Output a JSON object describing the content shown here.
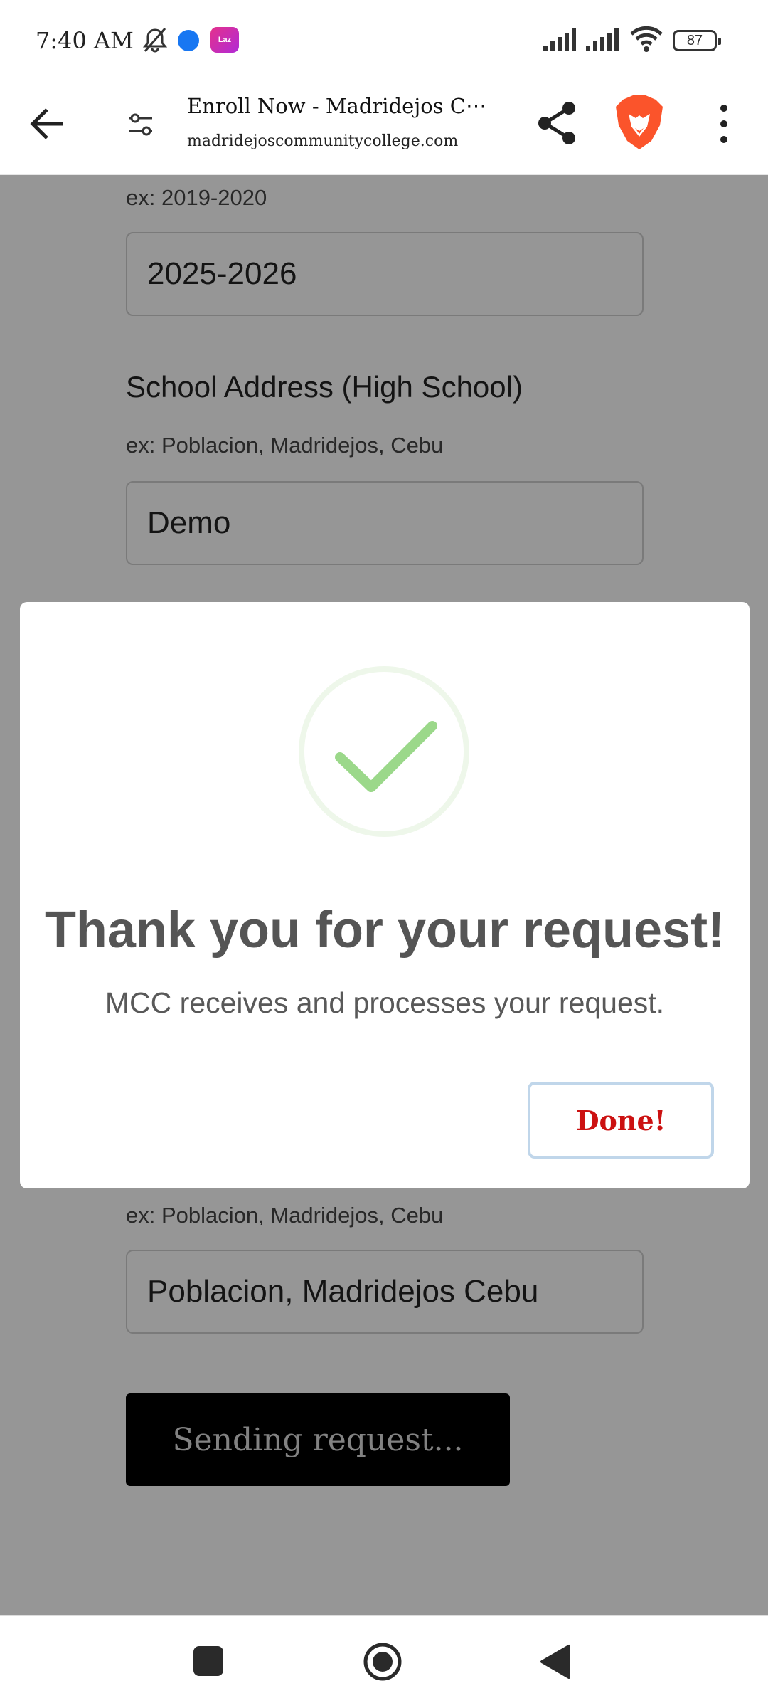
{
  "status_bar": {
    "time": "7:40 AM",
    "battery": "87",
    "icons": [
      "bell-off-icon",
      "messenger-icon",
      "lazada-icon",
      "signal-icon",
      "signal-icon",
      "wifi-icon",
      "battery-icon"
    ],
    "laz_text": "Laz"
  },
  "toolbar": {
    "page_title": "Enroll Now - Madridejos C⋯",
    "url": "madridejoscommunitycollege.com"
  },
  "form": {
    "school_year_hint": "ex: 2019-2020",
    "school_year_value": "2025-2026",
    "hs_address_label": "School Address (High School)",
    "hs_address_hint": "ex: Poblacion, Madridejos, Cebu",
    "hs_address_value": "Demo",
    "address_hint": "ex: Poblacion, Madridejos, Cebu",
    "address_value": "Poblacion, Madridejos Cebu",
    "submit_label": "Sending request..."
  },
  "modal": {
    "title": "Thank you for your request!",
    "message": "MCC receives and processes your request.",
    "done_label": "Done!"
  },
  "colors": {
    "success_green": "#9bd88a",
    "done_red": "#cc1111",
    "overlay": "rgba(0,0,0,0.41)"
  }
}
